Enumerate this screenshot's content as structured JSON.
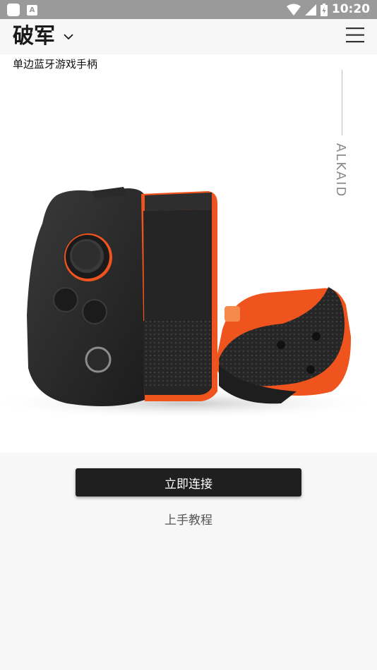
{
  "status_bar": {
    "time": "10:20",
    "notification_icons": [
      "app-notification-icon",
      "a-store-icon"
    ],
    "system_icons": [
      "wifi-icon",
      "cell-signal-icon",
      "battery-icon"
    ]
  },
  "header": {
    "title": "破军",
    "dropdown_icon": "chevron-down-icon",
    "menu_icon": "hamburger-menu-icon"
  },
  "hero": {
    "subtitle": "单边蓝牙游戏手柄",
    "brand_vertical": "ALKAID",
    "accent_color": "#f0541e",
    "image": "gamepad-product-image"
  },
  "actions": {
    "connect_label": "立即连接",
    "tutorial_label": "上手教程"
  }
}
